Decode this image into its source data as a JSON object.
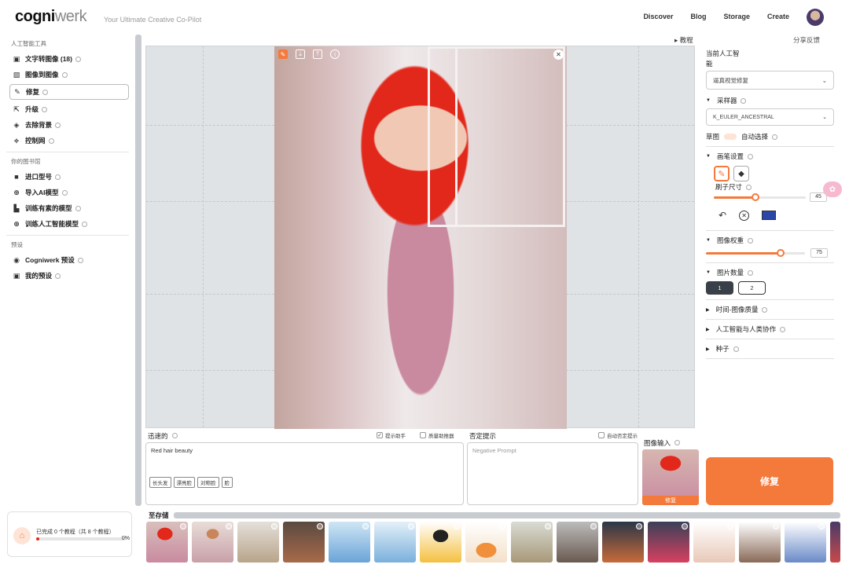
{
  "header": {
    "logo_bold": "cogni",
    "logo_thin": "werk",
    "tagline": "Your Ultimate Creative Co-Pilot",
    "nav": [
      "Discover",
      "Blog",
      "Storage",
      "Create"
    ]
  },
  "sidebar": {
    "section1_title": "人工智能工具",
    "tools": [
      {
        "label": "文字转图像 (18)",
        "icon": "text-image-icon"
      },
      {
        "label": "图像到图像",
        "icon": "image-icon"
      },
      {
        "label": "修复",
        "icon": "brush-icon",
        "active": true
      },
      {
        "label": "升级",
        "icon": "upscale-icon"
      },
      {
        "label": "去除背景",
        "icon": "eraser-icon"
      },
      {
        "label": "控制网",
        "icon": "controlnet-icon"
      }
    ],
    "section2_title": "你的图书馆",
    "library": [
      {
        "label": "进口型号",
        "icon": "import-icon"
      },
      {
        "label": "导入AI模型",
        "icon": "plus-circle-icon"
      },
      {
        "label": "训练有素的模型",
        "icon": "model-icon"
      },
      {
        "label": "训练人工智能模型",
        "icon": "plus-circle-icon"
      }
    ],
    "section3_title": "预设",
    "presets": [
      {
        "label": "Cogniwerk 预设",
        "icon": "preset-icon"
      },
      {
        "label": "我的预设",
        "icon": "user-icon"
      }
    ]
  },
  "canvas": {
    "tutorial_label": "教程",
    "feedback_label": "分享反馈"
  },
  "prompt": {
    "label": "迅速的",
    "assistant_label": "提示助手",
    "batch_label": "质量助推器",
    "value": "Red hair beauty",
    "tags": [
      "长头发",
      "漂亮脸",
      "对称脸",
      "脸"
    ],
    "negative_label": "否定提示",
    "auto_negative_label": "自动否定提示",
    "negative_placeholder": "Negative Prompt",
    "image_input_label": "图像输入",
    "image_input_button": "修复"
  },
  "right_panel": {
    "model_title": "当前人工智能",
    "model_value": "逼真视觉修复",
    "sampler_label": "采样器",
    "sampler_value": "K_EULER_ANCESTRAL",
    "sketch_label": "草图",
    "auto_select_label": "自动选择",
    "brush_section": "画笔设置",
    "brush_size_label": "刷子尺寸",
    "brush_size": "45",
    "brush_size_fraction": 0.45,
    "brush_color": "#2946a8",
    "image_weight_label": "图像权重",
    "image_weight": "75",
    "image_weight_fraction": 0.75,
    "image_count_label": "图片数量",
    "image_count_options": [
      "1",
      "2"
    ],
    "collapsed": [
      "时间-图像质量",
      "人工智能与人类协作",
      "种子"
    ],
    "action_button": "修复"
  },
  "progress": {
    "text": "已完成 0 个教程（共 8 个教程）",
    "percent": "0%"
  },
  "storage": {
    "label": "至存储"
  },
  "colors": {
    "accent": "#f47a3c",
    "handle": "#c8ccd0"
  }
}
